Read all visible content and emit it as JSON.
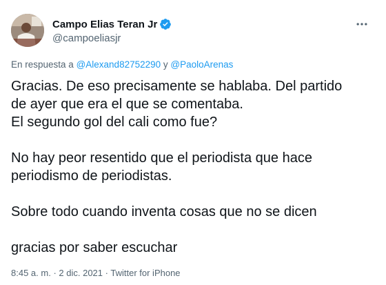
{
  "author": {
    "display_name": "Campo Elias Teran Jr",
    "handle": "@campoeliasjr",
    "verified": true
  },
  "icons": {
    "avatar": "profile-photo",
    "verified": "verified-badge-icon",
    "more": "more-options-icon"
  },
  "reply": {
    "prefix": "En respuesta a",
    "user1": "@Alexand82752290",
    "connector": "y",
    "user2": "@PaoloArenas"
  },
  "tweet": {
    "lines": [
      "Gracias. De eso precisamente se hablaba. Del partido",
      "de ayer que era el que se comentaba.",
      "El segundo gol del cali como fue?",
      "",
      "No hay peor resentido que el periodista que hace",
      "periodismo de periodistas.",
      "",
      "Sobre todo cuando inventa cosas que no se dicen",
      "",
      "gracias por saber escuchar"
    ]
  },
  "meta": {
    "time": "8:45 a. m.",
    "separator1": "·",
    "date": "2 dic. 2021",
    "separator2": "·",
    "source": "Twitter for iPhone"
  },
  "colors": {
    "accent": "#1d9bf0",
    "text": "#0f1419",
    "secondary": "#536471"
  }
}
